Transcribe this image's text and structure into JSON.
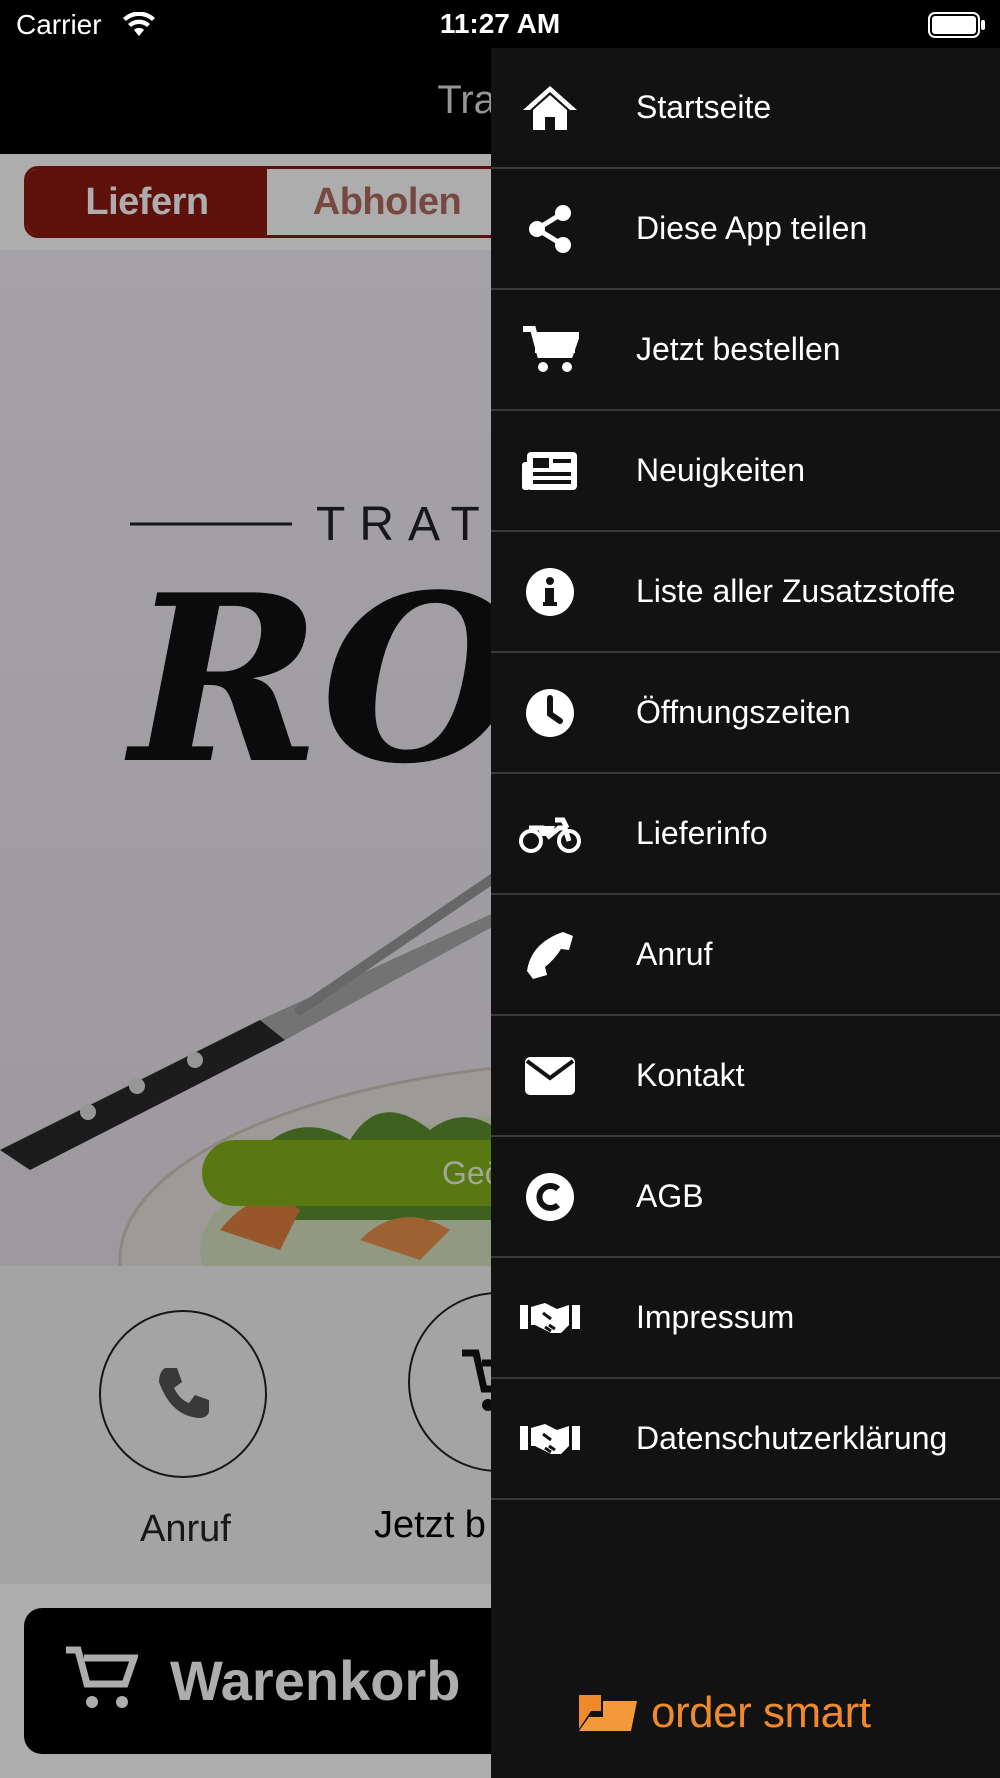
{
  "status_bar": {
    "carrier": "Carrier",
    "time": "11:27 AM"
  },
  "nav": {
    "title": "Trattori"
  },
  "segment": {
    "deliver_label": "Liefern",
    "pickup_label": "Abholen"
  },
  "hero": {
    "logo_top": "TRATT",
    "logo_main": "RO",
    "open_badge": "Geö"
  },
  "actions": {
    "call_label": "Anruf",
    "order_label": "Jetzt b"
  },
  "cart": {
    "label": "Warenkorb"
  },
  "menu": {
    "items": [
      {
        "label": "Startseite",
        "icon": "home-icon"
      },
      {
        "label": "Diese App teilen",
        "icon": "share-icon"
      },
      {
        "label": "Jetzt bestellen",
        "icon": "cart-icon"
      },
      {
        "label": "Neuigkeiten",
        "icon": "newspaper-icon"
      },
      {
        "label": "Liste aller Zusatzstoffe",
        "icon": "info-icon"
      },
      {
        "label": "Öffnungszeiten",
        "icon": "clock-icon"
      },
      {
        "label": "Lieferinfo",
        "icon": "motorcycle-icon"
      },
      {
        "label": "Anruf",
        "icon": "phone-icon"
      },
      {
        "label": "Kontakt",
        "icon": "envelope-icon"
      },
      {
        "label": "AGB",
        "icon": "copyright-icon"
      },
      {
        "label": "Impressum",
        "icon": "handshake-icon"
      },
      {
        "label": "Datenschutzerklärung",
        "icon": "handshake-icon"
      }
    ],
    "brand": "order smart"
  },
  "colors": {
    "accent_red": "#8b1a0f",
    "open_green": "#83b21a",
    "brand_orange": "#ee8a2c",
    "menu_bg": "#121212"
  }
}
